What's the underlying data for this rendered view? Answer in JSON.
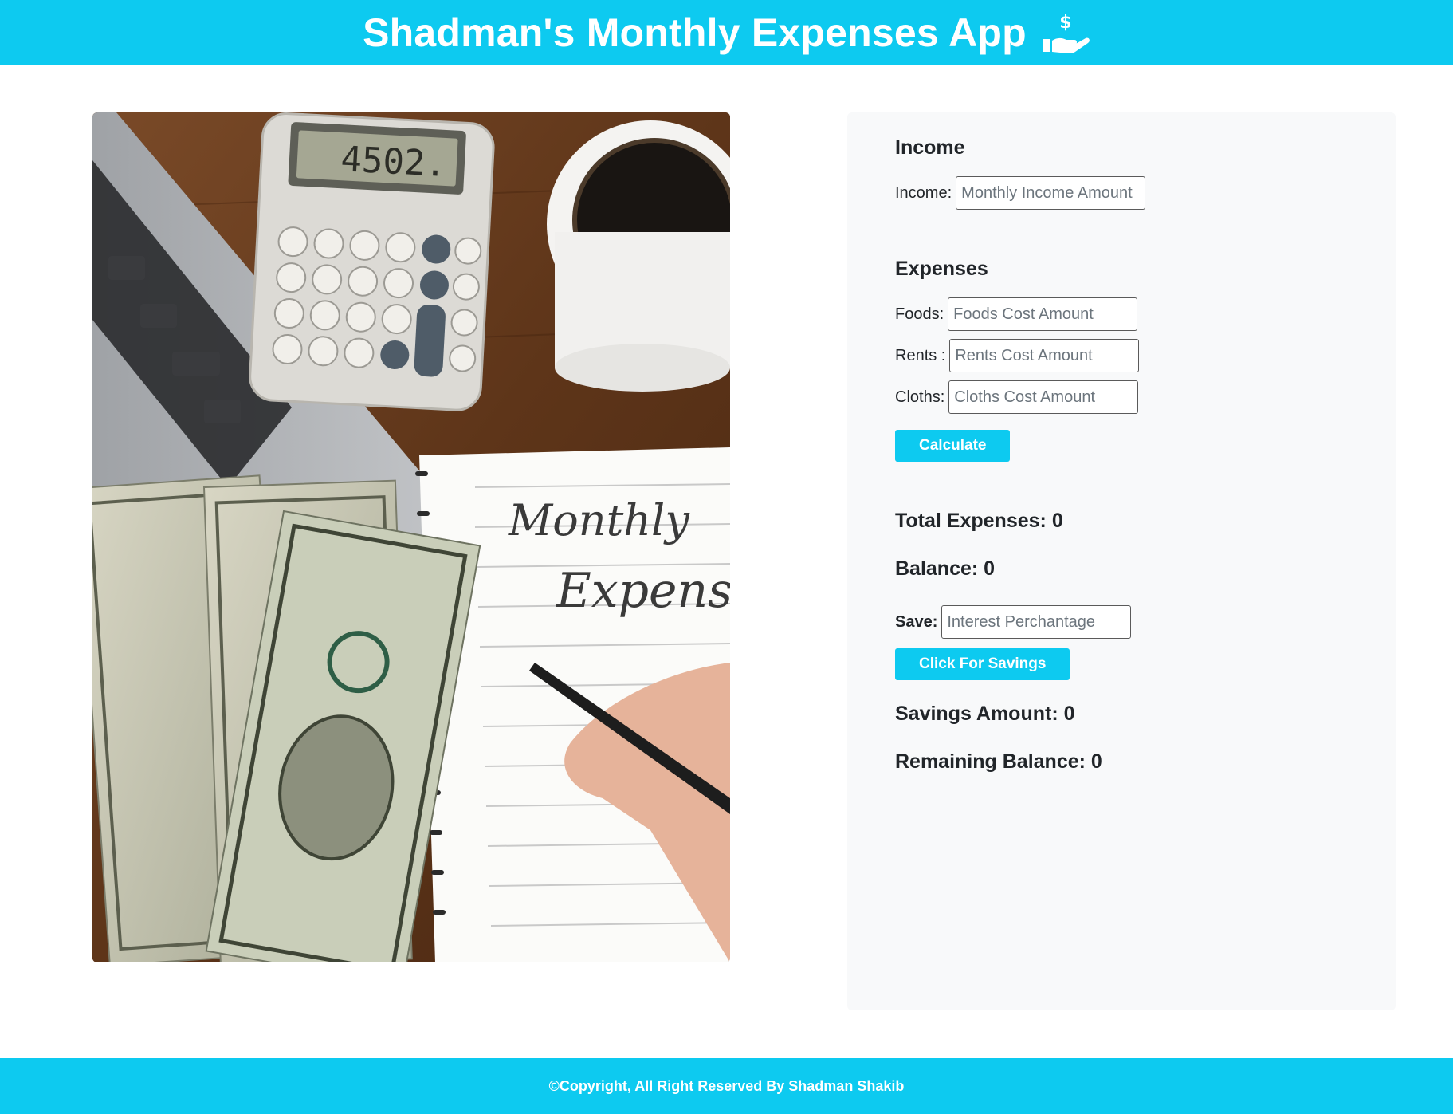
{
  "app": {
    "title": "Shadman's Monthly Expenses App",
    "title_icon": "hand-holding-dollar-icon",
    "accent_color": "#0dcaf0",
    "panel_color": "#f8f9fa"
  },
  "photo": {
    "calculator_display": "4502.",
    "notepad_line_1": "Monthly",
    "notepad_line_2": "Expens"
  },
  "income": {
    "heading": "Income",
    "label": "Income:",
    "placeholder": "Monthly Income Amount",
    "value": ""
  },
  "expenses": {
    "heading": "Expenses",
    "items": [
      {
        "label": "Foods:",
        "placeholder": "Foods Cost Amount",
        "value": ""
      },
      {
        "label": "Rents :",
        "placeholder": "Rents Cost Amount",
        "value": ""
      },
      {
        "label": "Cloths:",
        "placeholder": "Cloths Cost Amount",
        "value": ""
      }
    ],
    "calculate_label": "Calculate"
  },
  "results": {
    "total_expenses": "Total Expenses: 0",
    "balance": "Balance: 0"
  },
  "savings": {
    "label": "Save:",
    "placeholder": "Interest Perchantage",
    "value": "",
    "button_label": "Click For Savings",
    "savings_amount": "Savings Amount: 0",
    "remaining_balance": "Remaining Balance: 0"
  },
  "footer": {
    "text": "©Copyright, All Right Reserved By Shadman Shakib"
  }
}
